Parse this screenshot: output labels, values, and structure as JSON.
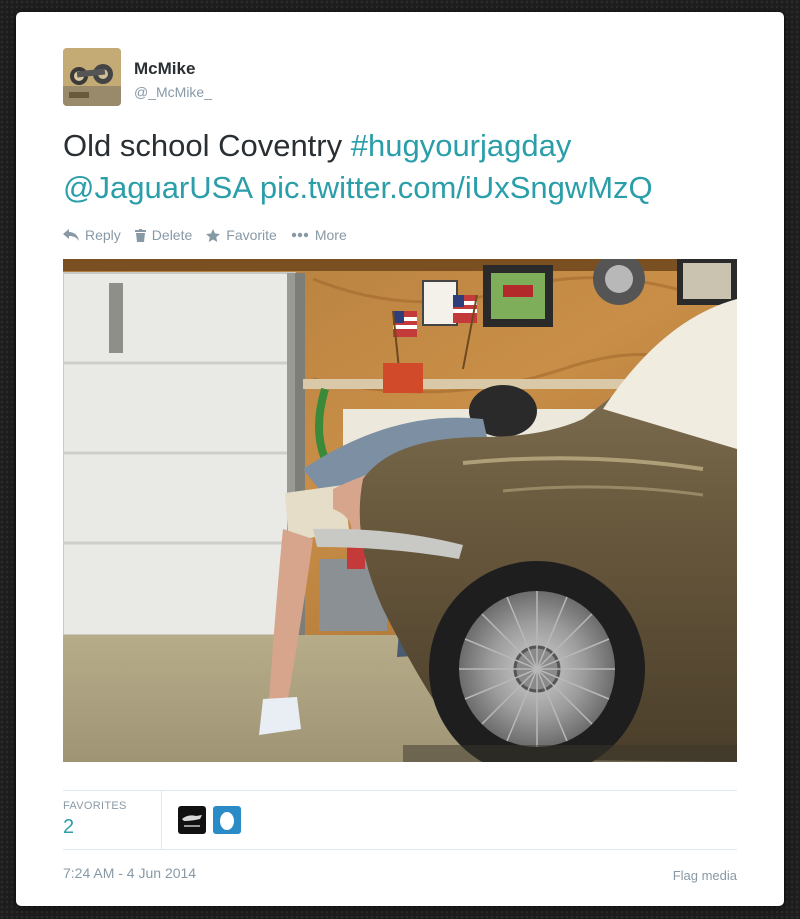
{
  "tweet": {
    "author_name": "McMike",
    "author_handle": "@_McMike_",
    "text_plain": "Old school Coventry ",
    "hashtag": "#hugyourjagday",
    "mention": "@JaguarUSA",
    "pic_link": "pic.twitter.com/iUxSngwMzQ",
    "timestamp": "7:24 AM - 4 Jun 2014"
  },
  "actions": {
    "reply": "Reply",
    "delete": "Delete",
    "favorite": "Favorite",
    "more": "More"
  },
  "stats": {
    "favorites_label": "FAVORITES",
    "favorites_count": "2",
    "favoriters": [
      {
        "icon": "jaguar-logo-avatar"
      },
      {
        "icon": "default-egg-avatar"
      }
    ]
  },
  "footer": {
    "flag_media": "Flag media"
  },
  "colors": {
    "link": "#2a9ea9",
    "muted": "#8899a6",
    "text": "#292f33"
  }
}
